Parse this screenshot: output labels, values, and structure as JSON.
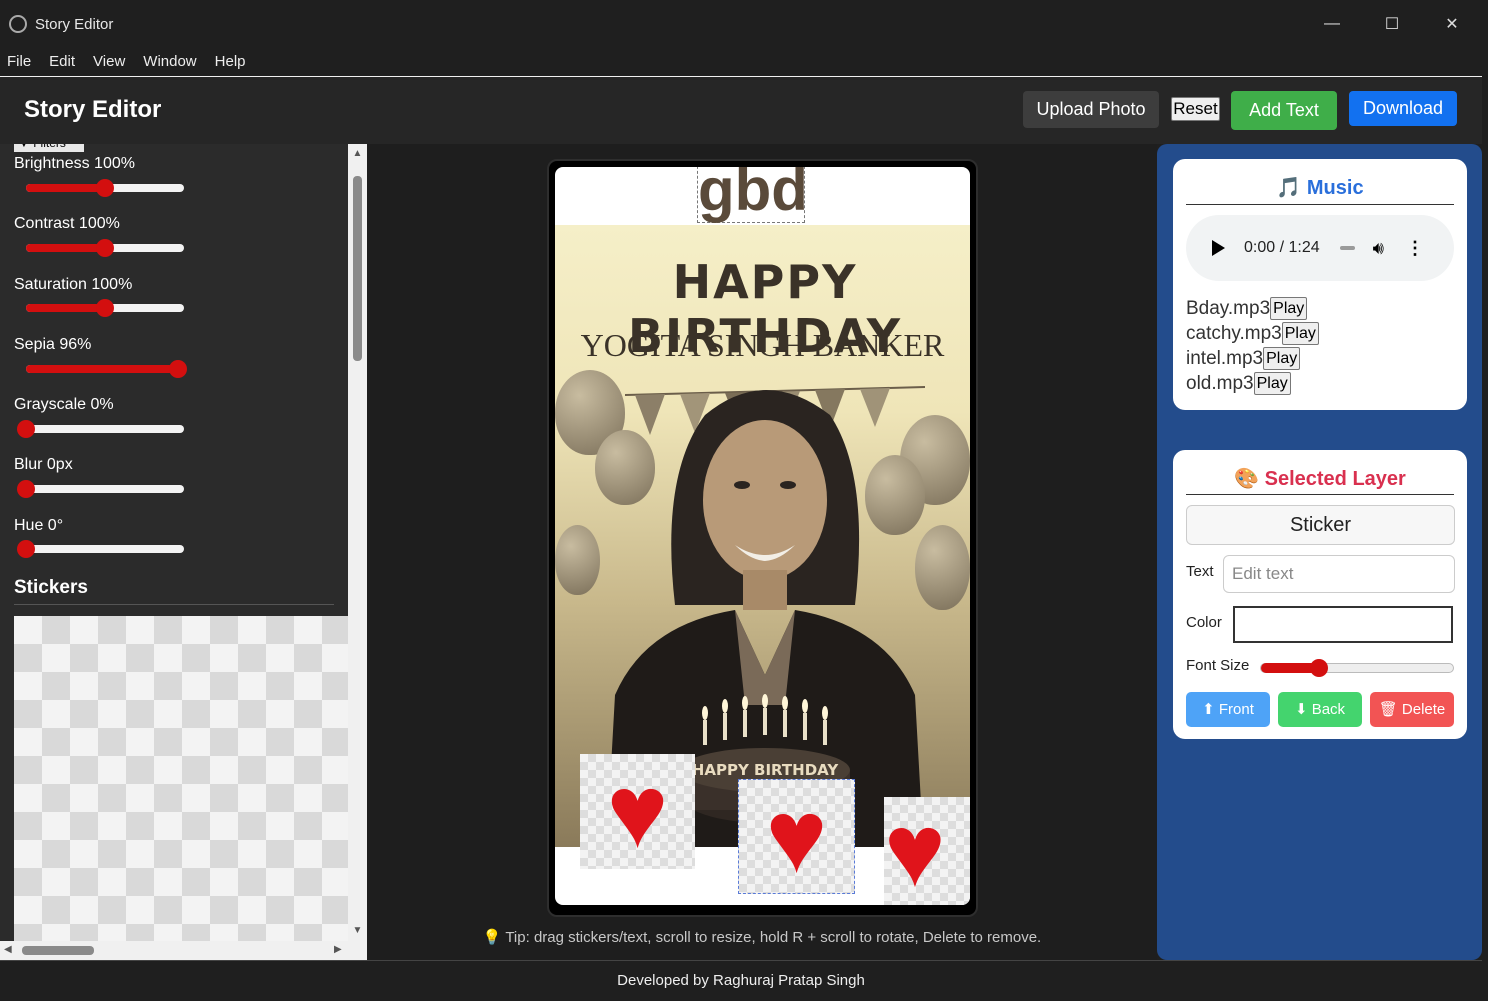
{
  "window": {
    "title": "Story Editor",
    "minimize": "—",
    "maximize": "☐",
    "close": "✕"
  },
  "menu": [
    "File",
    "Edit",
    "View",
    "Window",
    "Help"
  ],
  "header": {
    "title": "Story Editor",
    "upload_label": "Upload Photo",
    "reset_label": "Reset",
    "add_text_label": "Add Text",
    "download_label": "Download"
  },
  "filters": {
    "toggle_label": "▼ Filters",
    "items": [
      {
        "label": "Brightness 100%",
        "level": 0.5
      },
      {
        "label": "Contrast 100%",
        "level": 0.5
      },
      {
        "label": "Saturation 100%",
        "level": 0.5
      },
      {
        "label": "Sepia 96%",
        "level": 0.96
      },
      {
        "label": "Grayscale 0%",
        "level": 0.0
      },
      {
        "label": "Blur 0px",
        "level": 0.0
      },
      {
        "label": "Hue 0°",
        "level": 0.0
      }
    ]
  },
  "stickers": {
    "heading": "Stickers"
  },
  "canvas": {
    "text_layer": "gbd",
    "banner_title": "HAPPY BIRTHDAY",
    "banner_name": "YOGITA SINGH BANKER",
    "cake_text": "HAPPY BIRTHDAY",
    "tip": "💡 Tip: drag stickers/text, scroll to resize, hold R + scroll to rotate, Delete to remove."
  },
  "music": {
    "heading": "🎵 Music",
    "player_time": "0:00 / 1:24",
    "tracks": [
      {
        "name": "Bday.mp3",
        "button": "Play"
      },
      {
        "name": "catchy.mp3",
        "button": "Play"
      },
      {
        "name": "intel.mp3",
        "button": "Play"
      },
      {
        "name": "old.mp3",
        "button": "Play"
      }
    ]
  },
  "layer": {
    "heading": "🎨 Selected Layer",
    "type": "Sticker",
    "text_label": "Text",
    "text_placeholder": "Edit text",
    "color_label": "Color",
    "font_size_label": "Font Size",
    "font_size_level": 0.3,
    "front_label": "⬆ Front",
    "back_label": "⬇ Back",
    "delete_label": "🗑 Delete"
  },
  "footer": "Developed by Raghuraj Pratap Singh",
  "colors": {
    "accent_green": "#3fae49",
    "accent_blue": "#1271f0",
    "slider_red": "#d30f0f",
    "panel_blue": "#234c8c",
    "music_heading": "#2a6fdb",
    "layer_heading": "#d9304f"
  }
}
